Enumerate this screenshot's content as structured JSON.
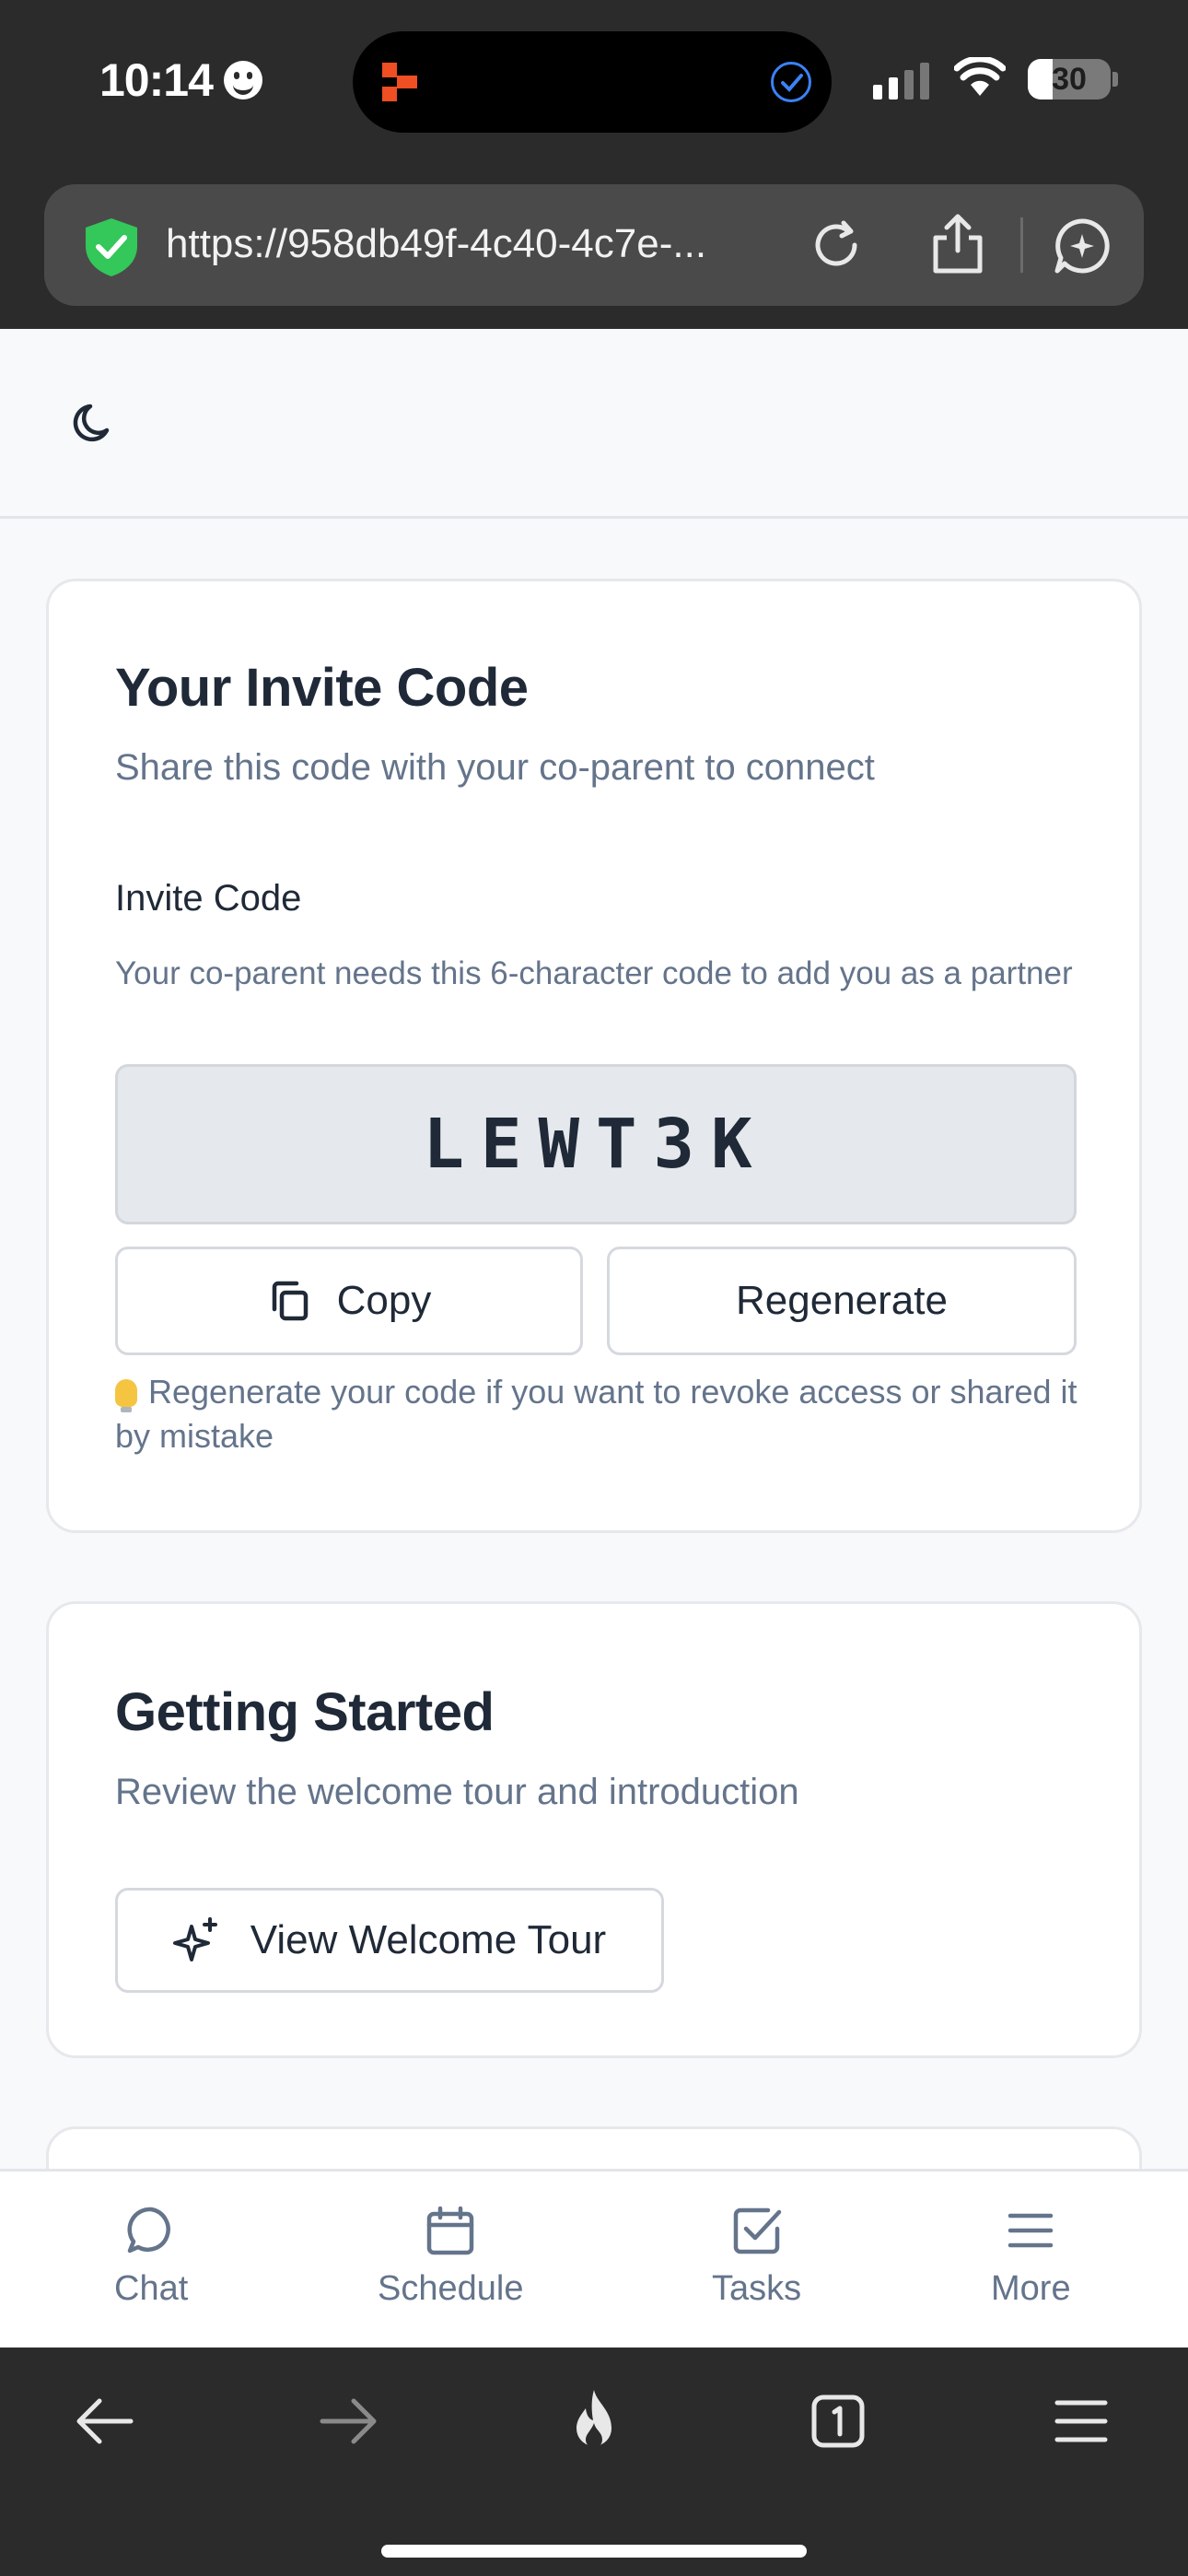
{
  "status_bar": {
    "time": "10:14",
    "battery": "30",
    "battery_fraction": 0.3
  },
  "browser": {
    "url": "https://958db49f-4c40-4c7e-..."
  },
  "invite_card": {
    "title": "Your Invite Code",
    "subtitle": "Share this code with your co-parent to connect",
    "field_label": "Invite Code",
    "field_help": "Your co-parent needs this 6-character code to add you as a partner",
    "code": "LEWT3K",
    "copy_label": "Copy",
    "regenerate_label": "Regenerate",
    "tip": "Regenerate your code if you want to revoke access or shared it by mistake"
  },
  "getting_started_card": {
    "title": "Getting Started",
    "subtitle": "Review the welcome tour and introduction",
    "tour_label": "View Welcome Tour"
  },
  "bottom_nav": [
    {
      "label": "Chat",
      "icon": "chat-bubble-icon"
    },
    {
      "label": "Schedule",
      "icon": "calendar-icon"
    },
    {
      "label": "Tasks",
      "icon": "checkbox-icon"
    },
    {
      "label": "More",
      "icon": "menu-icon"
    }
  ],
  "colors": {
    "accent_text": "#1f2937",
    "muted_text": "#64748b",
    "chrome": "#2b2b2b",
    "shield_green": "#34c759"
  }
}
